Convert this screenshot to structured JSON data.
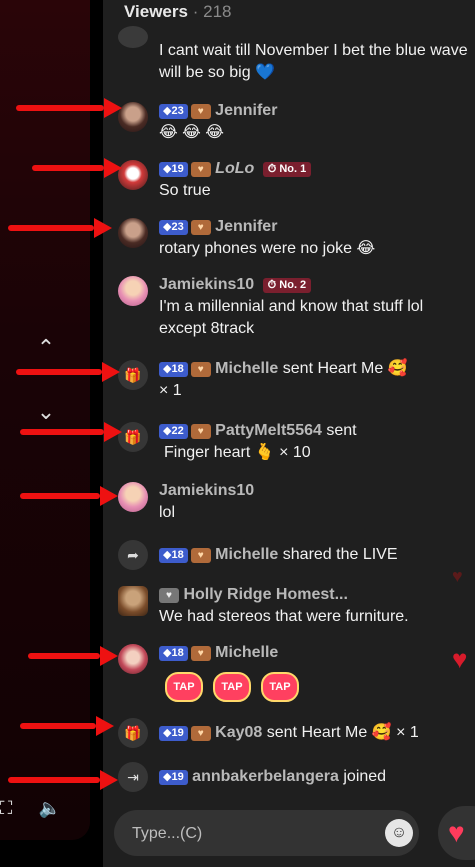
{
  "header": {
    "title": "Viewers",
    "sep": "·",
    "count": "218"
  },
  "left": {
    "up": "⌃",
    "down": "⌄",
    "volume": "🔈",
    "frame": "⛶"
  },
  "messages": [
    {
      "text": "I cant wait till November I bet the blue wave will be so big 💙"
    },
    {
      "level": "23",
      "name": "Jennifer",
      "text": "😂 😂 😂"
    },
    {
      "level": "19",
      "name": "LoLo",
      "rank": "No. 1",
      "text": "So true"
    },
    {
      "level": "23",
      "name": "Jennifer",
      "text": "rotary phones were no joke 😂"
    },
    {
      "name": "Jamiekins10",
      "rank": "No. 2",
      "text": "I'm a millennial and know that stuff lol except 8track"
    },
    {
      "level": "18",
      "name": "Michelle",
      "text": "sent Heart Me 🥰",
      "count": "× 1"
    },
    {
      "level": "22",
      "name": "PattyMelt5564",
      "text": "sent",
      "gift": "Finger heart 🫰 × 10"
    },
    {
      "name": "Jamiekins10",
      "text": "lol"
    },
    {
      "level": "18",
      "name": "Michelle",
      "text": "shared the LIVE"
    },
    {
      "name": "Holly Ridge Homest...",
      "text": "We had stereos that were furniture."
    },
    {
      "level": "18",
      "name": "Michelle",
      "tap": [
        "TAP",
        "TAP",
        "TAP"
      ]
    },
    {
      "level": "19",
      "name": "Kay08",
      "text": "sent Heart Me 🥰 × 1"
    },
    {
      "level": "19",
      "name": "annbakerbelangera",
      "text": "joined"
    }
  ],
  "input": {
    "placeholder": "Type...(C)"
  },
  "icons": {
    "gift": "gift-icon",
    "share": "share-icon",
    "join": "join-icon",
    "emoji": "emoji-icon",
    "like": "heart-icon"
  },
  "colors": {
    "level_badge": "#3d5ccc",
    "rank_badge": "#7a1f2e",
    "arrow": "#ee1111",
    "heart": "#ff3b5c"
  }
}
